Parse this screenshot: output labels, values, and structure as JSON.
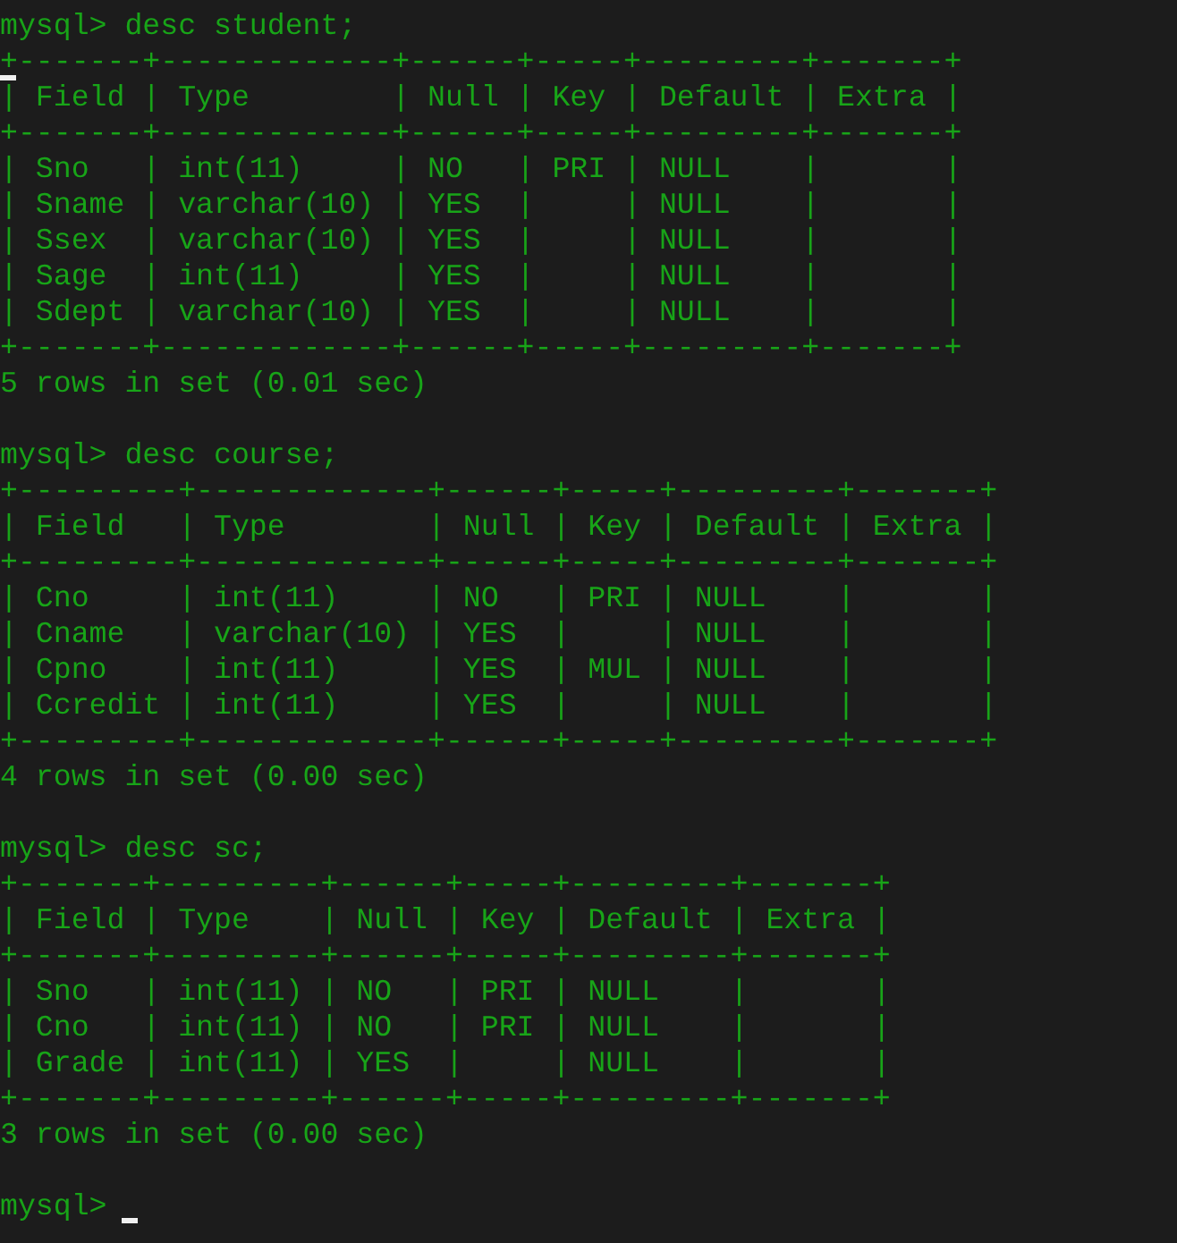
{
  "terminal": {
    "lines": [
      {
        "text": "mysql> desc student;"
      },
      {
        "text": "+-------+-------------+------+-----+---------+-------+",
        "marker": true
      },
      {
        "text": "| Field | Type        | Null | Key | Default | Extra |"
      },
      {
        "text": "+-------+-------------+------+-----+---------+-------+"
      },
      {
        "text": "| Sno   | int(11)     | NO   | PRI | NULL    |       |"
      },
      {
        "text": "| Sname | varchar(10) | YES  |     | NULL    |       |"
      },
      {
        "text": "| Ssex  | varchar(10) | YES  |     | NULL    |       |"
      },
      {
        "text": "| Sage  | int(11)     | YES  |     | NULL    |       |"
      },
      {
        "text": "| Sdept | varchar(10) | YES  |     | NULL    |       |"
      },
      {
        "text": "+-------+-------------+------+-----+---------+-------+"
      },
      {
        "text": "5 rows in set (0.01 sec)"
      },
      {
        "kind": "blank"
      },
      {
        "text": "mysql> desc course;"
      },
      {
        "text": "+---------+-------------+------+-----+---------+-------+"
      },
      {
        "text": "| Field   | Type        | Null | Key | Default | Extra |"
      },
      {
        "text": "+---------+-------------+------+-----+---------+-------+"
      },
      {
        "text": "| Cno     | int(11)     | NO   | PRI | NULL    |       |"
      },
      {
        "text": "| Cname   | varchar(10) | YES  |     | NULL    |       |"
      },
      {
        "text": "| Cpno    | int(11)     | YES  | MUL | NULL    |       |"
      },
      {
        "text": "| Ccredit | int(11)     | YES  |     | NULL    |       |"
      },
      {
        "text": "+---------+-------------+------+-----+---------+-------+"
      },
      {
        "text": "4 rows in set (0.00 sec)"
      },
      {
        "kind": "blank"
      },
      {
        "text": "mysql> desc sc;"
      },
      {
        "text": "+-------+---------+------+-----+---------+-------+"
      },
      {
        "text": "| Field | Type    | Null | Key | Default | Extra |"
      },
      {
        "text": "+-------+---------+------+-----+---------+-------+"
      },
      {
        "text": "| Sno   | int(11) | NO   | PRI | NULL    |       |"
      },
      {
        "text": "| Cno   | int(11) | NO   | PRI | NULL    |       |"
      },
      {
        "text": "| Grade | int(11) | YES  |     | NULL    |       |"
      },
      {
        "text": "+-------+---------+------+-----+---------+-------+"
      },
      {
        "text": "3 rows in set (0.00 sec)"
      },
      {
        "kind": "blank"
      },
      {
        "text": "mysql>",
        "cursor": true
      }
    ]
  }
}
